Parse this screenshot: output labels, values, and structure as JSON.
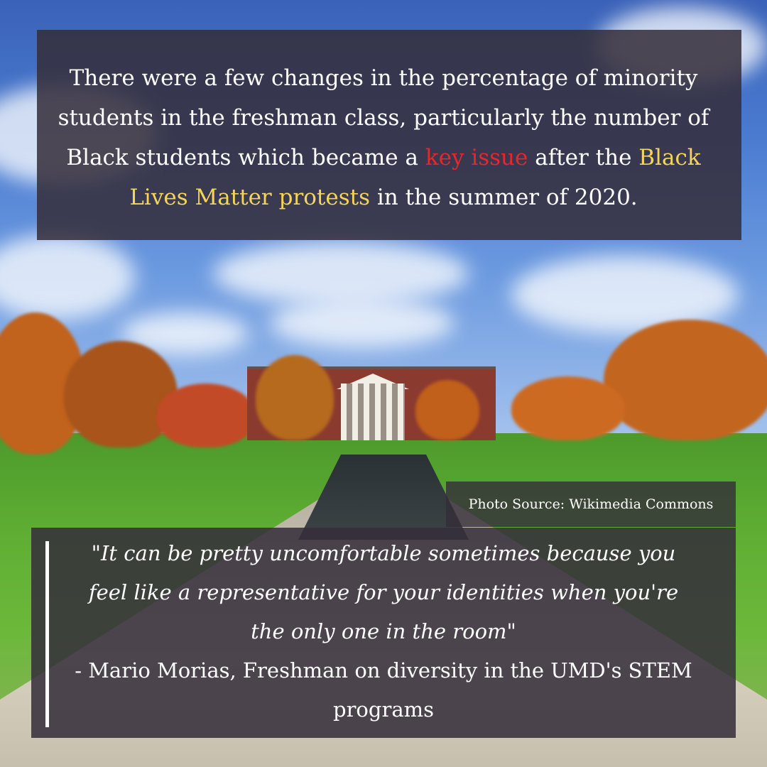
{
  "top_text": {
    "part1": "There were a few changes in the percentage of minority",
    "part2": "students in the freshman class, particularly the number of",
    "part3": "Black students which became a",
    "highlight_red": "key issue",
    "part4": "after the",
    "highlight_yellow_1": "Black",
    "highlight_yellow_2": "Lives Matter protests",
    "part5": "in the summer of 2020."
  },
  "photo_source": "Photo Source: Wikimedia Commons",
  "quote": {
    "line1": "\"It can be pretty uncomfortable sometimes because you",
    "line2": "feel like a representative for your identities when you're",
    "line3": "the only one in the room\"",
    "attribution1": "- Mario Morias, Freshman on diversity in the UMD's STEM",
    "attribution2": "programs"
  },
  "colors": {
    "overlay": "#342d3a",
    "highlight_red": "#e8262b",
    "highlight_yellow": "#f5d45a",
    "text": "#ffffff"
  }
}
